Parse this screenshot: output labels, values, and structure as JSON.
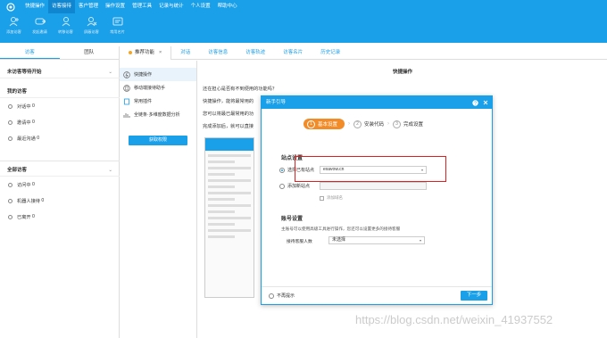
{
  "menu": {
    "items": [
      "快捷操作",
      "访客接待",
      "客户管理",
      "操作设置",
      "管理工具",
      "记录与统计",
      "个人设置",
      "帮助中心"
    ],
    "active_index": 1
  },
  "toolbar": {
    "items": [
      {
        "label": "添加访客",
        "icon": "add-visitor-icon"
      },
      {
        "label": "发起邀请",
        "icon": "invite-icon"
      },
      {
        "label": "转移访客",
        "icon": "transfer-icon"
      },
      {
        "label": "屏蔽访客",
        "icon": "block-icon"
      },
      {
        "label": "常用名片",
        "icon": "card-icon"
      }
    ]
  },
  "left_panel": {
    "tabs": [
      "访客",
      "团队"
    ],
    "active_tab": 0,
    "unstarted_header": "未访客等待开始",
    "my_header": "我的访客",
    "my_items": [
      {
        "label": "对话中",
        "count": "0"
      },
      {
        "label": "邀请中",
        "count": "0"
      },
      {
        "label": "最近沟通",
        "count": "0"
      }
    ],
    "all_header": "全部访客",
    "all_items": [
      {
        "label": "访问中",
        "count": "0"
      },
      {
        "label": "机器人接待",
        "count": "0"
      },
      {
        "label": "已离开",
        "count": "0"
      }
    ]
  },
  "center_tabs": {
    "items": [
      "推荐功能",
      "对话",
      "访客信息",
      "访客轨迹",
      "访客名片",
      "历史记录"
    ],
    "active_index": 0,
    "close": "×"
  },
  "quick_panel": {
    "items": [
      {
        "label": "快捷操作",
        "icon": "lightning-icon"
      },
      {
        "label": "移动端接待助手",
        "icon": "mobile-icon"
      },
      {
        "label": "常用插件",
        "icon": "plugin-icon"
      },
      {
        "label": "全链条·多维度数据分析",
        "icon": "chart-icon"
      }
    ],
    "button": "获取权限"
  },
  "content": {
    "title": "快捷操作",
    "lines": [
      "还在担心是否有不到便用的功能吗？",
      "快捷操作，能将最常用的",
      "您可以将最已最常用的功",
      "完成添加后，就可以直接"
    ]
  },
  "dialog": {
    "title": "新手引导",
    "steps": [
      {
        "num": "1",
        "label": "基本设置"
      },
      {
        "num": "2",
        "label": "安装代码"
      },
      {
        "num": "3",
        "label": "完成设置"
      }
    ],
    "site_section": "站点设置",
    "select_site_label": "选择已有站点",
    "select_site_value": "exavow.cn",
    "add_site_label": "添加新站点",
    "domain_check": "添加域名",
    "account_section": "账号设置",
    "account_desc": "主账号可以使用高级工具进行操作，您还可以设置更多的接待客服",
    "agent_count_label": "接待客服人数",
    "agent_count_value": "未选择",
    "dont_show": "不再提示",
    "next": "下一步"
  },
  "watermark": "https://blog.csdn.net/weixin_41937552",
  "colors": {
    "brand": "#1a9fe9",
    "step_active": "#f28c28",
    "highlight": "#e02020"
  }
}
